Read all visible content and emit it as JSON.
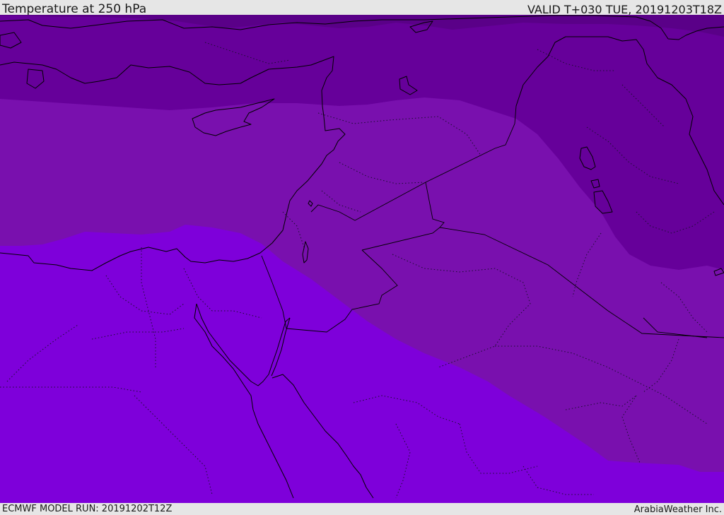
{
  "header": {
    "title": "Temperature at 250 hPa",
    "valid": "VALID T+030 TUE, 20191203T18Z"
  },
  "footer": {
    "model_run": "ECMWF MODEL RUN: 20191202T12Z",
    "provider": "ArabiaWeather Inc."
  },
  "colors": {
    "band_coldest": "#5a0088",
    "band_cold": "#66009a",
    "band_mid": "#7910ae",
    "band_warm": "#7e00da",
    "frame": "#e6e6e6",
    "lines": "#000000"
  }
}
